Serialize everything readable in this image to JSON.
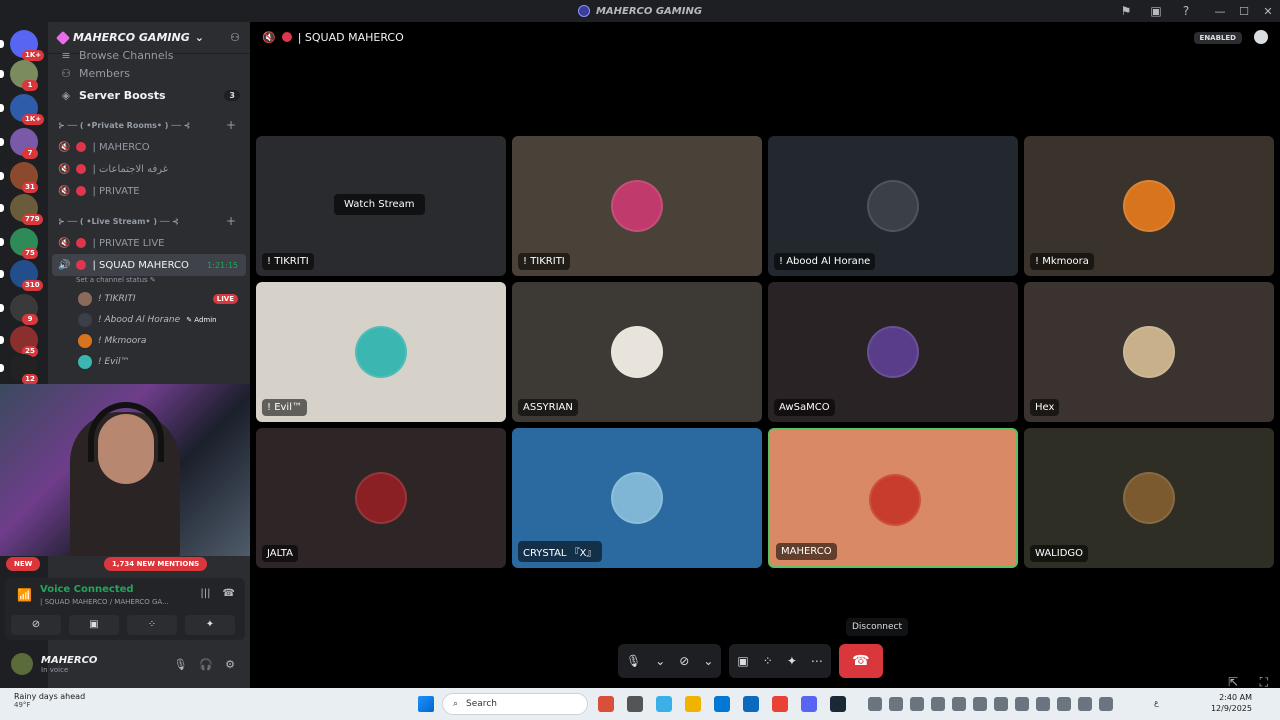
{
  "window": {
    "title": "MAHERCO GAMING",
    "controls": [
      "—",
      "☐",
      "✕"
    ]
  },
  "server_rail": {
    "items": [
      {
        "badge": "1K+",
        "color": "#5865f2"
      },
      {
        "badge": "1",
        "color": "#7a8b5e"
      },
      {
        "badge": "1K+",
        "color": "#2f5ca8"
      },
      {
        "badge": "7",
        "color": "#7a5aa8"
      },
      {
        "badge": "31",
        "color": "#8b4a2e"
      },
      {
        "badge": "779",
        "color": "#6a5c3a"
      },
      {
        "badge": "75",
        "color": "#2e8b57"
      },
      {
        "badge": "310",
        "color": "#234e8c"
      },
      {
        "badge": "9",
        "color": "#3a3a3a"
      },
      {
        "badge": "25",
        "color": "#8b2e2e"
      },
      {
        "badge": "12",
        "color": "#222222"
      }
    ]
  },
  "sidebar": {
    "server_name": "MAHERCO GAMING",
    "top_items": [
      {
        "label": "Browse Channels",
        "icon": "list-icon"
      },
      {
        "label": "Members",
        "icon": "members-icon"
      },
      {
        "label": "Server Boosts",
        "icon": "boost-icon",
        "count": "3"
      }
    ],
    "categories": [
      {
        "label": "⊱ ── ( •Private Rooms• ) ── ⊰",
        "channels": [
          {
            "name": "| MAHERCO"
          },
          {
            "name": "| غرفه الاجتماعات"
          },
          {
            "name": "| PRIVATE"
          }
        ]
      },
      {
        "label": "⊱ ── ( •Live Stream• ) ── ⊰",
        "channels": [
          {
            "name": "| PRIVATE LIVE"
          },
          {
            "name": "| SQUAD MAHERCO",
            "timer": "1:21:15",
            "status": "Set a channel status ✎"
          }
        ]
      }
    ],
    "members": [
      {
        "name": "! TIKRITI",
        "tag": "LIVE"
      },
      {
        "name": "! Abood Al Horane",
        "tag": "Admin"
      },
      {
        "name": "! Mkmoora",
        "tag": ""
      },
      {
        "name": "! Evil™",
        "tag": ""
      }
    ],
    "new_label": "NEW",
    "mentions_label": "1,734 NEW MENTIONS",
    "voice": {
      "status": "Voice Connected",
      "location": "| SQUAD MAHERCO / MAHERCO GA..."
    },
    "user": {
      "name": "MAHERCO",
      "status": "In voice"
    }
  },
  "stage": {
    "channel": "| SQUAD MAHERCO",
    "enabled_badge": "ENABLED",
    "watch_stream": "Watch Stream",
    "tooltip": "Disconnect",
    "tiles": [
      {
        "name": "! TIKRITI",
        "bg": "#2a2b2e",
        "av": "#4a4d55",
        "stream": true
      },
      {
        "name": "! TIKRITI",
        "bg": "#4a4238",
        "av": "#c03a6b"
      },
      {
        "name": "! Abood Al Horane",
        "bg": "#23282f",
        "av": "#3b4048"
      },
      {
        "name": "! Mkmoora",
        "bg": "#3a332c",
        "av": "#d8741e"
      },
      {
        "name": "! Evil™",
        "bg": "#d6d2ca",
        "av": "#3bb6b0"
      },
      {
        "name": "ASSYRIAN",
        "bg": "#3d3a36",
        "av": "#e8e4dc"
      },
      {
        "name": "AwSaMCO",
        "bg": "#2a2326",
        "av": "#5a3d8a"
      },
      {
        "name": "Hex",
        "bg": "#3a332f",
        "av": "#c7b08a"
      },
      {
        "name": "JALTA",
        "bg": "#2e2527",
        "av": "#8b2024"
      },
      {
        "name": "CRYSTAL 『X』",
        "bg": "#2a6aa0",
        "av": "#7fb6d6"
      },
      {
        "name": "MAHERCO",
        "bg": "#d98963",
        "av": "#c73c2a",
        "speaking": true
      },
      {
        "name": "WALIDGO",
        "bg": "#2e2e24",
        "av": "#7a5a2e"
      }
    ]
  },
  "taskbar": {
    "weather": "Rainy days ahead",
    "temp": "49°F",
    "search_placeholder": "Search",
    "time": "2:40 AM",
    "date": "12/9/2025",
    "lang": "ع",
    "apps": [
      "#d94f3a",
      "#555",
      "#3ab0e8",
      "#f0b400",
      "#0078d4",
      "#0b6abf",
      "#e94235",
      "#5865f2",
      "#1b2838"
    ]
  }
}
